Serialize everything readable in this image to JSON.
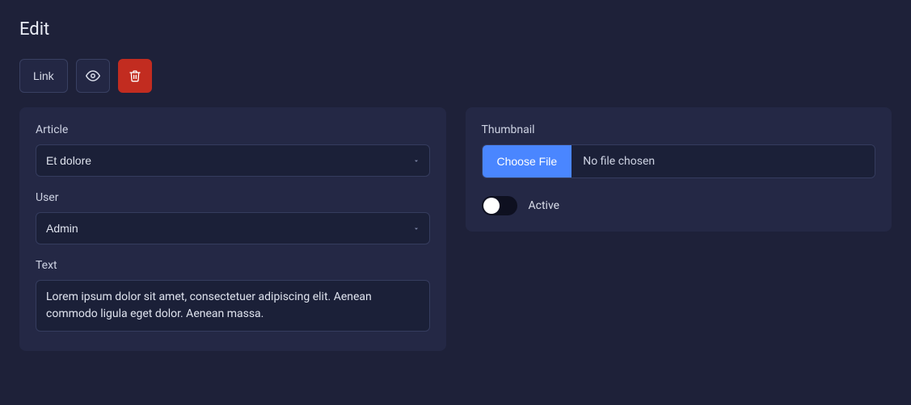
{
  "page": {
    "title": "Edit"
  },
  "toolbar": {
    "link_label": "Link",
    "preview_icon": "eye-icon",
    "delete_icon": "trash-icon"
  },
  "form": {
    "article": {
      "label": "Article",
      "selected": "Et dolore"
    },
    "user": {
      "label": "User",
      "selected": "Admin"
    },
    "text": {
      "label": "Text",
      "value": "Lorem ipsum dolor sit amet, consectetuer adipiscing elit. Aenean commodo ligula eget dolor. Aenean massa."
    },
    "thumbnail": {
      "label": "Thumbnail",
      "choose_label": "Choose File",
      "status": "No file chosen"
    },
    "active": {
      "label": "Active",
      "value": false
    }
  }
}
